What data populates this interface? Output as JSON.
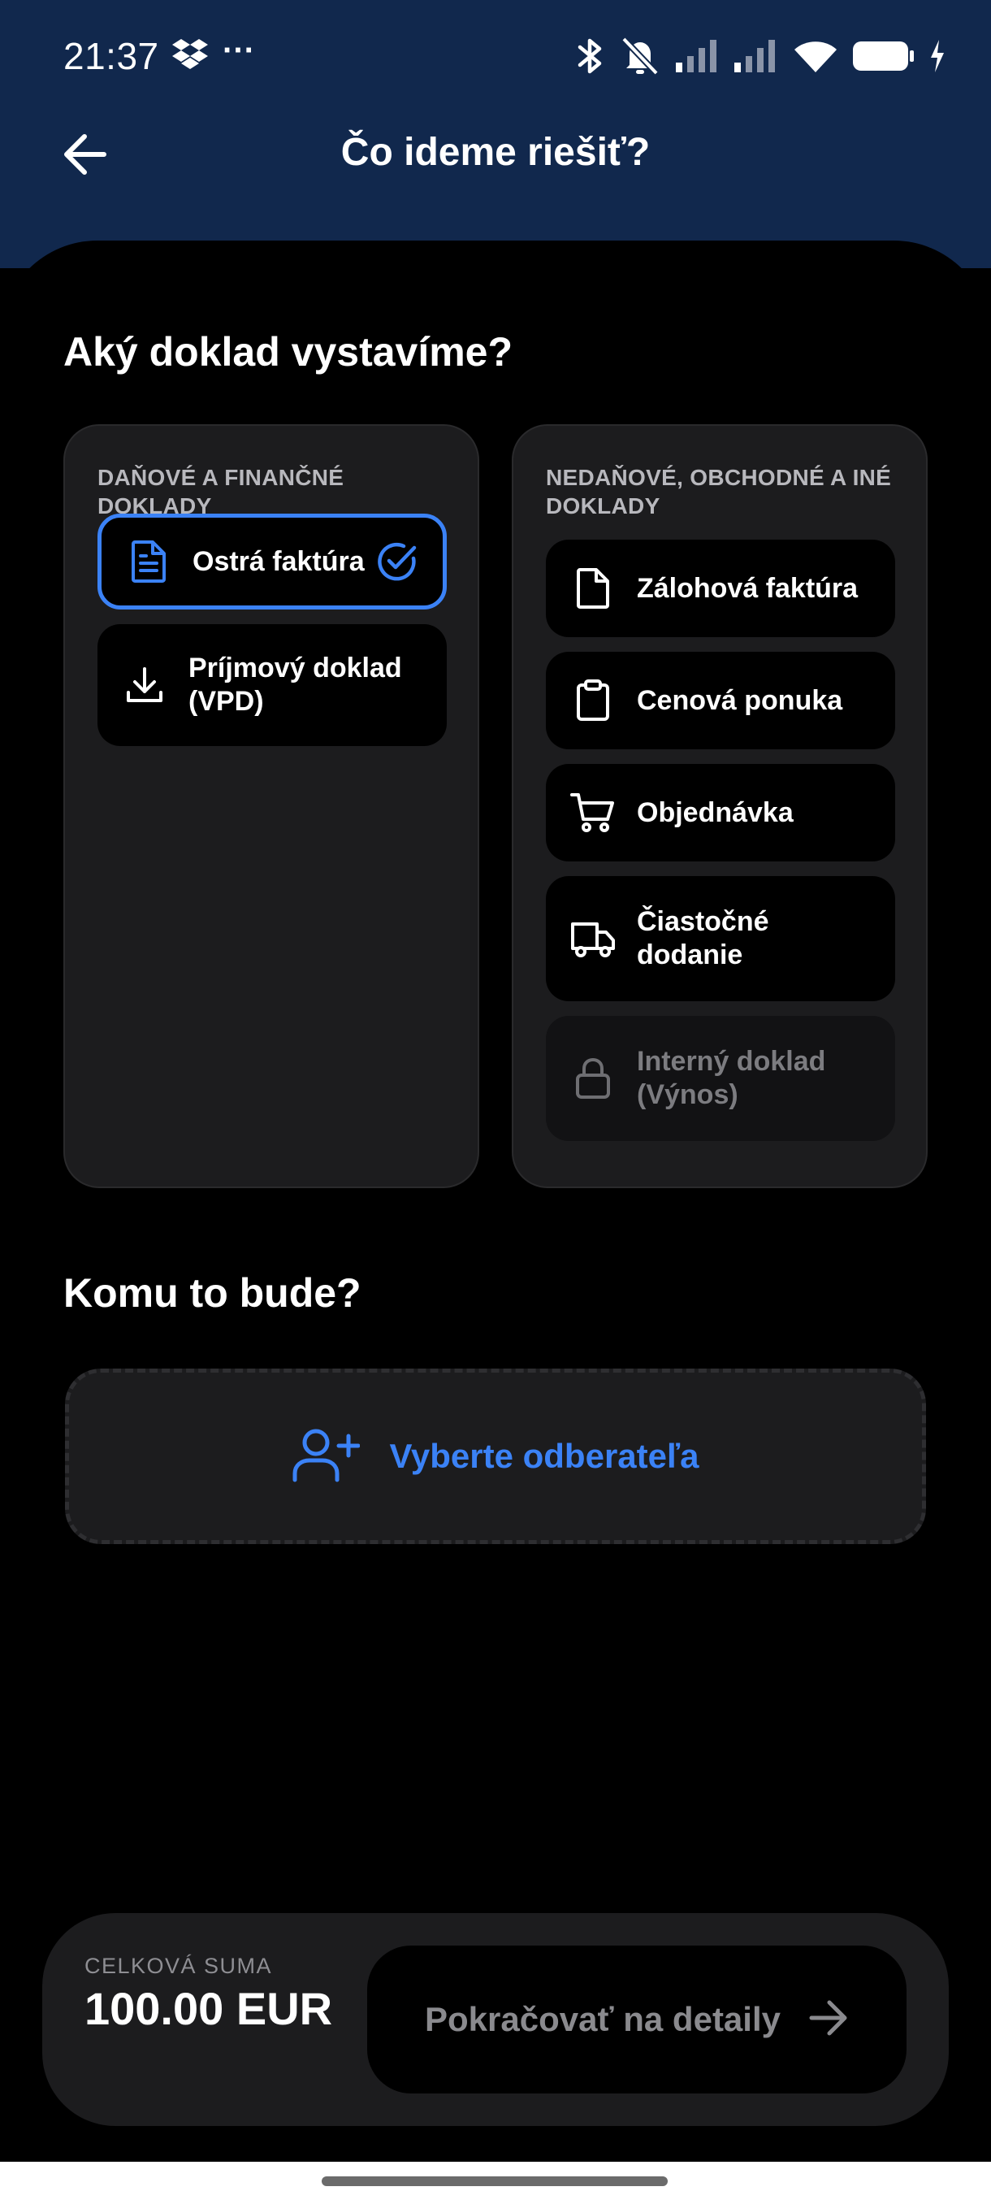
{
  "status_bar": {
    "time": "21:37",
    "overflow": "···",
    "icons": [
      "dropbox-icon",
      "bluetooth-icon",
      "bell-off-icon",
      "signal-icon",
      "signal-icon",
      "wifi-icon",
      "battery-icon",
      "charging-icon"
    ]
  },
  "header": {
    "title": "Čo ideme riešiť?",
    "back_icon": "arrow-left-icon"
  },
  "document_section": {
    "title": "Aký doklad vystavíme?",
    "tax_panel": {
      "heading": "DAŇOVÉ A FINANČNÉ DOKLADY",
      "items": [
        {
          "label": "Ostrá faktúra",
          "icon": "document-icon",
          "selected": true
        },
        {
          "label": "Príjmový doklad (VPD)",
          "icon": "download-icon",
          "selected": false
        }
      ]
    },
    "nontax_panel": {
      "heading": "NEDAŇOVÉ, OBCHODNÉ A INÉ DOKLADY",
      "items": [
        {
          "label": "Zálohová faktúra",
          "icon": "file-icon",
          "disabled": false
        },
        {
          "label": "Cenová ponuka",
          "icon": "clipboard-icon",
          "disabled": false
        },
        {
          "label": "Objednávka",
          "icon": "cart-icon",
          "disabled": false
        },
        {
          "label": "Čiastočné dodanie",
          "icon": "truck-icon",
          "disabled": false
        },
        {
          "label": "Interný doklad (Výnos)",
          "icon": "lock-icon",
          "disabled": true
        }
      ]
    }
  },
  "customer_section": {
    "title": "Komu to bude?",
    "select_label": "Vyberte odberateľa",
    "icon": "user-plus-icon"
  },
  "bottom_bar": {
    "total_label": "CELKOVÁ SUMA",
    "total_value": "100.00 EUR",
    "continue_label": "Pokračovať na detaily",
    "continue_icon": "arrow-right-icon"
  },
  "colors": {
    "header_bg": "#11284d",
    "accent": "#3b82f6",
    "panel_bg": "#1c1c1e",
    "item_bg": "#000000",
    "disabled_text": "#7c7c80"
  }
}
